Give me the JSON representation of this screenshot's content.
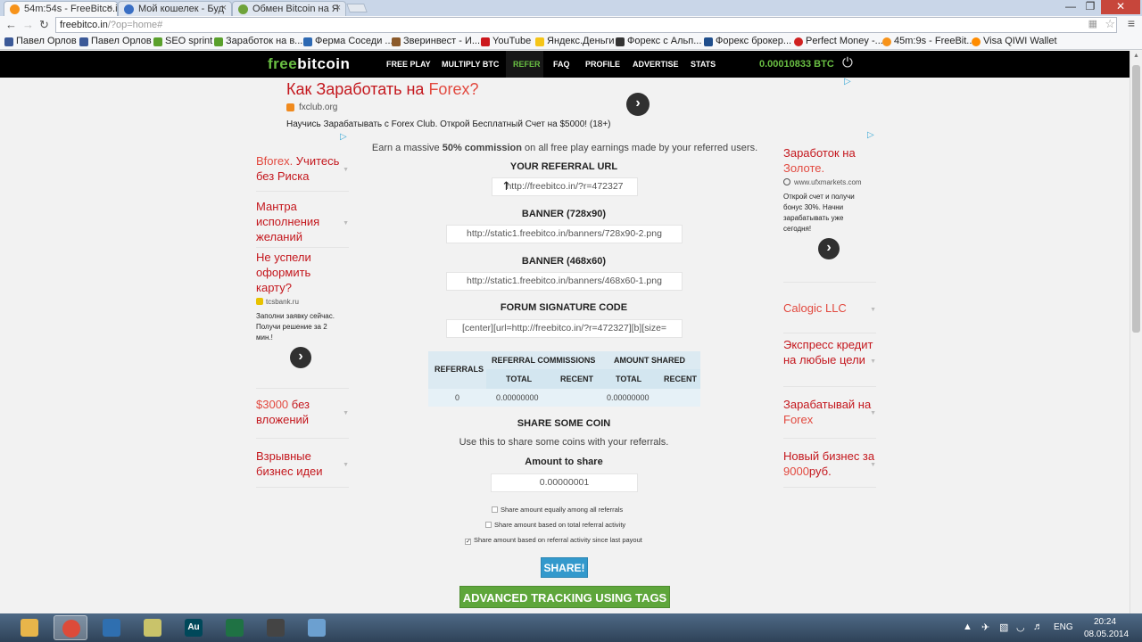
{
  "browser": {
    "tabs": [
      {
        "label": "54m:54s - FreeBitco.i",
        "active": true,
        "icon_color": "#f7931a"
      },
      {
        "label": "Мой кошелек - Буд",
        "active": false,
        "icon_color": "#3a6fc4"
      },
      {
        "label": "Обмен Bitcoin на Я",
        "active": false,
        "icon_color": "#6fa33a"
      }
    ],
    "close_glyph": "×",
    "url_host": "freebitco.in",
    "url_rest": "/?op=home#",
    "bookmarks": [
      {
        "label": "Павел Орлов",
        "icon_color": "#3b5998"
      },
      {
        "label": "Павел Орлов",
        "icon_color": "#3b5998"
      },
      {
        "label": "SEO sprint",
        "icon_color": "#5aa02c"
      },
      {
        "label": "Заработок на в...",
        "icon_color": "#5aa02c"
      },
      {
        "label": "Ферма Соседи ...",
        "icon_color": "#2d69b3"
      },
      {
        "label": "Зверинвест - И...",
        "icon_color": "#8b5a2b"
      },
      {
        "label": "YouTube",
        "icon_color": "#cc181e"
      },
      {
        "label": "Яндекс.Деньги",
        "icon_color": "#f5c518"
      },
      {
        "label": "Форекс с Альп...",
        "icon_color": "#333333"
      },
      {
        "label": "Форекс брокер...",
        "icon_color": "#1f4e8c"
      },
      {
        "label": "Perfect Money -...",
        "icon_color": "#d02020"
      },
      {
        "label": "45m:9s - FreeBit...",
        "icon_color": "#f7931a"
      },
      {
        "label": "Visa QIWI Wallet",
        "icon_color": "#ff8c00"
      }
    ]
  },
  "site": {
    "logo_free": "free",
    "logo_bitcoin": "bitcoin",
    "nav": [
      "FREE PLAY",
      "MULTIPLY BTC",
      "REFER",
      "FAQ",
      "PROFILE",
      "ADVERTISE",
      "STATS"
    ],
    "balance": "0.00010833 BTC"
  },
  "top_ad": {
    "title_a": "Как Заработать на ",
    "title_b": "Forex?",
    "url": "fxclub.org",
    "desc": "Научись Зарабатывать с Forex Club. Открой Бесплатный Счет на $5000! (18+)"
  },
  "left_ads": {
    "ad1_a": "Bforex.",
    "ad1_b": " Учитесь без Риска",
    "ad2": "Мантра исполнения желаний",
    "ad3": "Не успели оформить карту?",
    "ad3_url": "tcsbank.ru",
    "ad3_desc": "Заполни заявку сейчас. Получи решение за 2 мин.!",
    "ad4_a": "$3000",
    "ad4_b": " без вложений",
    "ad5": "Взрывные бизнес идеи"
  },
  "right_ads": {
    "ad1_a": "Заработок на ",
    "ad1_b": "Золоте.",
    "ad1_url": "www.ufxmarkets.com",
    "ad1_desc": "Открой счет и получи бонус 30%. Начни зарабатывать уже сегодня!",
    "ad2": "Calogic LLC",
    "ad3": "Экспресс кредит на любые цели",
    "ad4_a": "Зарабатывай на ",
    "ad4_b": "Forex",
    "ad5_a": "Новый бизнес за ",
    "ad5_b": "9000",
    "ad5_c": "руб."
  },
  "refer": {
    "earn_pre": "Earn a massive ",
    "earn_bold": "50% commission",
    "earn_post": " on all free play earnings made by your referred users.",
    "ref_url_heading": "YOUR REFERRAL URL",
    "ref_url": "http://freebitco.in/?r=472327",
    "banner728_heading": "BANNER (728x90)",
    "banner728_url": "http://static1.freebitco.in/banners/728x90-2.png",
    "banner468_heading": "BANNER (468x60)",
    "banner468_url": "http://static1.freebitco.in/banners/468x60-1.png",
    "forum_heading": "FORUM SIGNATURE CODE",
    "forum_code": "[center][url=http://freebitco.in/?r=472327][b][size="
  },
  "table": {
    "col_referrals": "REFERRALS",
    "col_commissions": "REFERRAL COMMISSIONS",
    "col_shared": "AMOUNT SHARED",
    "sub_total": "TOTAL",
    "sub_recent": "RECENT",
    "referrals": "0",
    "commissions_total": "0.00000000",
    "commissions_recent": "",
    "shared_total": "0.00000000",
    "shared_recent": ""
  },
  "share": {
    "heading": "SHARE SOME COIN",
    "desc": "Use this to share some coins with your referrals.",
    "amount_label": "Amount to share",
    "amount_value": "0.00000001",
    "options": [
      {
        "label": "Share amount equally among all referrals",
        "checked": false
      },
      {
        "label": "Share amount based on total referral activity",
        "checked": false
      },
      {
        "label": "Share amount based on referral activity since last payout",
        "checked": true
      }
    ],
    "button": "SHARE!",
    "advanced_button": "ADVANCED TRACKING USING TAGS"
  },
  "taskbar": {
    "apps": [
      {
        "name": "explorer",
        "color": "#e8b54a",
        "label": ""
      },
      {
        "name": "chrome",
        "color": "#dd4b39",
        "label": ""
      },
      {
        "name": "app3",
        "color": "#2f6fb0",
        "label": ""
      },
      {
        "name": "app4",
        "color": "#c9c36a",
        "label": ""
      },
      {
        "name": "audition",
        "color": "#00485a",
        "label": "Au"
      },
      {
        "name": "excel",
        "color": "#1f7244",
        "label": ""
      },
      {
        "name": "app7",
        "color": "#444444",
        "label": ""
      },
      {
        "name": "app8",
        "color": "#6ca0d0",
        "label": ""
      }
    ],
    "lang": "ENG",
    "time": "20:24",
    "date": "08.05.2014"
  }
}
